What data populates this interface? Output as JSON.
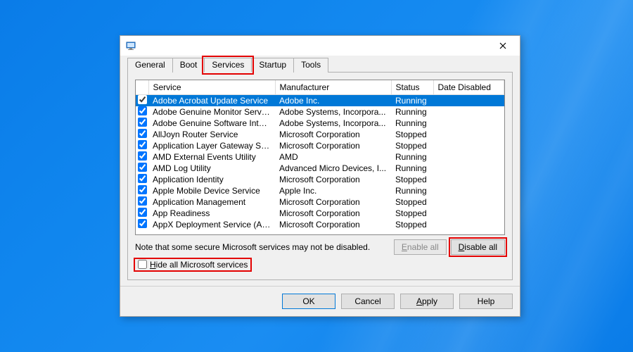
{
  "tabs": {
    "general": "General",
    "boot": "Boot",
    "services": "Services",
    "startup": "Startup",
    "tools": "Tools"
  },
  "columns": {
    "service": "Service",
    "manufacturer": "Manufacturer",
    "status": "Status",
    "date_disabled": "Date Disabled"
  },
  "rows": [
    {
      "svc": "Adobe Acrobat Update Service",
      "mfr": "Adobe Inc.",
      "status": "Running",
      "selected": true
    },
    {
      "svc": "Adobe Genuine Monitor Service",
      "mfr": "Adobe Systems, Incorpora...",
      "status": "Running"
    },
    {
      "svc": "Adobe Genuine Software Integri...",
      "mfr": "Adobe Systems, Incorpora...",
      "status": "Running"
    },
    {
      "svc": "AllJoyn Router Service",
      "mfr": "Microsoft Corporation",
      "status": "Stopped"
    },
    {
      "svc": "Application Layer Gateway Service",
      "mfr": "Microsoft Corporation",
      "status": "Stopped"
    },
    {
      "svc": "AMD External Events Utility",
      "mfr": "AMD",
      "status": "Running"
    },
    {
      "svc": "AMD Log Utility",
      "mfr": "Advanced Micro Devices, I...",
      "status": "Running"
    },
    {
      "svc": "Application Identity",
      "mfr": "Microsoft Corporation",
      "status": "Stopped"
    },
    {
      "svc": "Apple Mobile Device Service",
      "mfr": "Apple Inc.",
      "status": "Running"
    },
    {
      "svc": "Application Management",
      "mfr": "Microsoft Corporation",
      "status": "Stopped"
    },
    {
      "svc": "App Readiness",
      "mfr": "Microsoft Corporation",
      "status": "Stopped"
    },
    {
      "svc": "AppX Deployment Service (AppX...",
      "mfr": "Microsoft Corporation",
      "status": "Stopped"
    }
  ],
  "note": "Note that some secure Microsoft services may not be disabled.",
  "buttons": {
    "enable_all_prefix": "E",
    "enable_all_rest": "nable all",
    "disable_all_prefix": "D",
    "disable_all_rest": "isable all"
  },
  "hide_checkbox_prefix": "H",
  "hide_checkbox_rest": "ide all Microsoft services",
  "footer": {
    "ok": "OK",
    "cancel": "Cancel",
    "apply_prefix": "A",
    "apply_rest": "pply",
    "help": "Help"
  }
}
